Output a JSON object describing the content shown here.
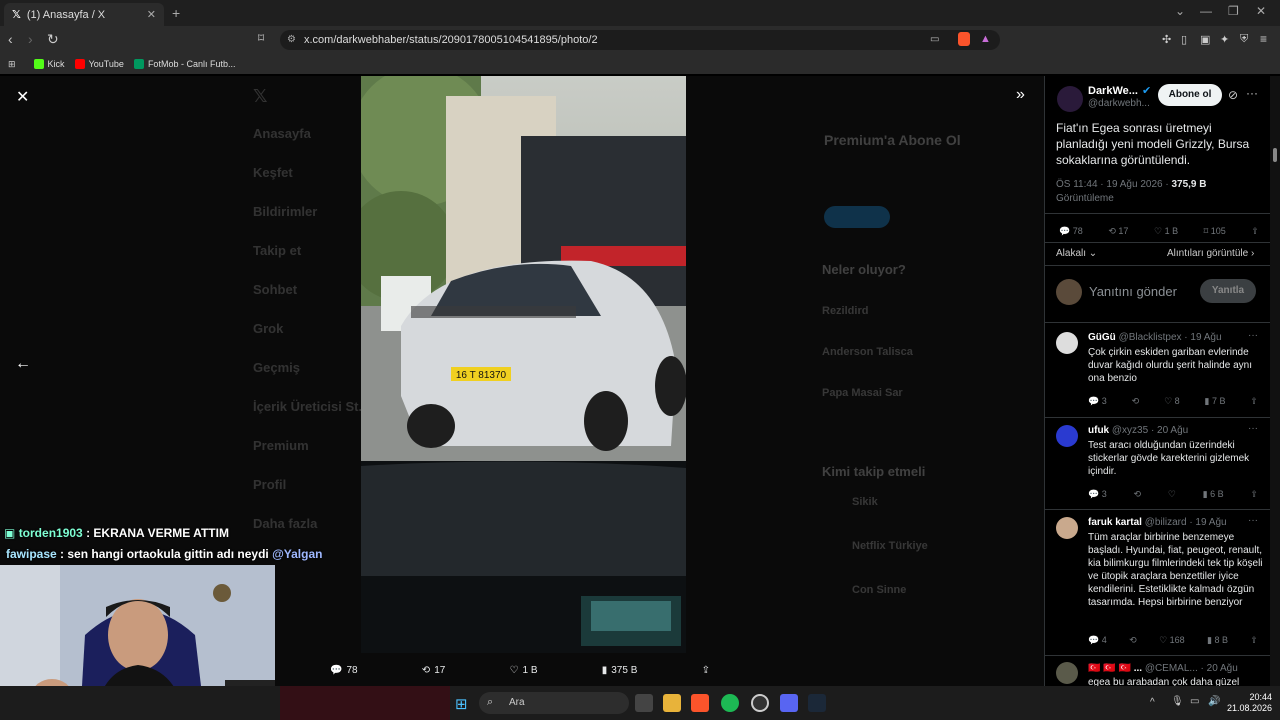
{
  "browser": {
    "tab_title": "(1) Anasayfa / X",
    "url": "x.com/darkwebhaber/status/2090178005104541895/photo/2",
    "bookmarks": [
      "Kick",
      "YouTube",
      "FotMob - Canlı Futb..."
    ]
  },
  "background": {
    "nav": [
      "Anasayfa",
      "Keşfet",
      "Bildirimler",
      "Takip et",
      "Sohbet",
      "Grok",
      "Geçmiş",
      "İçerik Üreticisi St...",
      "Premium",
      "Profil",
      "Daha fazla"
    ],
    "premium_title": "Premium'a Abone Ol",
    "whats_happening": "Neler oluyor?",
    "who_to_follow": "Kimi takip etmeli",
    "follow_names": [
      "Sikik",
      "Netflix Türkiye",
      "Con Sinne"
    ],
    "trend_items": [
      "Rezildird",
      "Anderson Talisca",
      "Papa Masai Sar"
    ]
  },
  "media_actions": {
    "replies": "78",
    "reposts": "17",
    "likes": "1 B",
    "views": "375 B"
  },
  "chat": [
    {
      "user": "torden1903",
      "text": ": EKRANA VERME ATTIM",
      "color": "#7fffd4"
    },
    {
      "user": "fawipase",
      "text": ": sen hangi ortaokula gittin adı neydi ",
      "mention": "@Yalgan",
      "color": "#a8e6ff"
    }
  ],
  "tweet": {
    "author": "DarkWe...",
    "handle": "@darkwebh...",
    "subscribe": "Abone ol",
    "text": "Fiat'ın Egea sonrası üretmeyi planladığı yeni modeli Grizzly, Bursa sokaklarına görüntülendi.",
    "meta": "ÖS 11:44 · 19 Ağu 2026 · ",
    "views_count": "375,9 B",
    "views_label": "Görüntüleme",
    "replies": "78",
    "reposts": "17",
    "likes": "1 B",
    "bookmarks": "105",
    "related": "Alakalı",
    "quotes": "Alıntıları görüntüle",
    "reply_placeholder": "Yanıtını gönder",
    "reply_button": "Yanıtla"
  },
  "replies": [
    {
      "name": "GüGü",
      "handle": "@Blacklistpex · 19 Ağu",
      "text": "Çok çirkin eskiden gariban evlerinde duvar kağıdı olurdu şerit halinde aynı ona benzio",
      "reply": "3",
      "like": "8",
      "views": "7 B"
    },
    {
      "name": "ufuk",
      "handle": "@xyz35 · 20 Ağu",
      "text": "Test aracı olduğundan üzerindeki stickerlar gövde karekterini gizlemek içindir.",
      "reply": "3",
      "like": "",
      "views": "6 B"
    },
    {
      "name": "faruk kartal",
      "handle": "@bilizard · 19 Ağu",
      "text": "Tüm araçlar birbirine benzemeye başladı.  Hyundai, fiat, peugeot, renault, kia bilimkurgu filmlerindeki tek tip köşeli ve ütopik araçlara benzettiler iyice kendilerini. Estetiklikte kalmadı özgün tasarımda. Hepsi birbirine benziyor",
      "reply": "4",
      "like": "168",
      "views": "8 B"
    },
    {
      "name": "🇹🇷 🇹🇷 🇹🇷 ...",
      "handle": "@CEMAL... · 20 Ağu",
      "text": "egea bu arabadan çok daha güzel",
      "reply": "",
      "like": "",
      "views": ""
    }
  ],
  "taskbar": {
    "search": "Ara",
    "time": "20:44",
    "date": "21.08.2026"
  },
  "photo": {
    "plate": "16 T 81370"
  }
}
